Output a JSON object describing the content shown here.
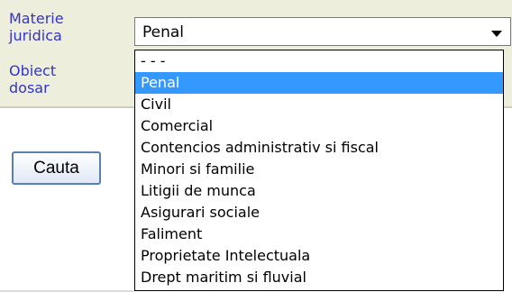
{
  "form": {
    "materie_label_line1": "Materie",
    "materie_label_line2": "juridica",
    "obiect_label_line1": "Obiect",
    "obiect_label_line2": "dosar"
  },
  "materie_select": {
    "selected_value": "Penal",
    "options": [
      "- - -",
      "Penal",
      "Civil",
      "Comercial",
      "Contencios administrativ si fiscal",
      "Minori si familie",
      "Litigii de munca",
      "Asigurari sociale",
      "Faliment",
      "Proprietate Intelectuala",
      "Drept maritim si fluvial"
    ],
    "highlighted_option": "Penal"
  },
  "search_button": {
    "label": "Cauta"
  },
  "colors": {
    "panel_background": "#eeeedd",
    "label_color": "#3333cc",
    "highlight": "#3399ff"
  }
}
